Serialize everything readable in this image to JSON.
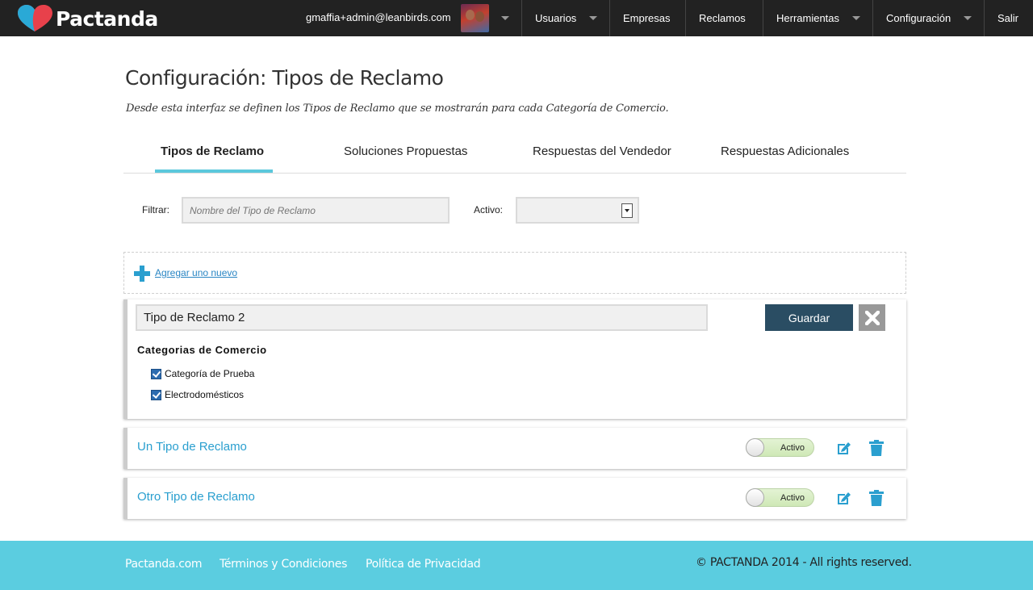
{
  "header": {
    "logo_text": "Pactanda",
    "user_email": "gmaffia+admin@leanbirds.com",
    "nav": [
      {
        "label": "Usuarios"
      },
      {
        "label": "Empresas"
      },
      {
        "label": "Reclamos"
      },
      {
        "label": "Herramientas"
      },
      {
        "label": "Configuración"
      },
      {
        "label": "Salir"
      }
    ]
  },
  "page": {
    "title": "Configuración: Tipos de Reclamo",
    "description": "Desde esta interfaz se definen los Tipos de Reclamo que se mostrarán para cada Categoría de Comercio."
  },
  "tabs": [
    {
      "label": "Tipos de Reclamo",
      "active": true
    },
    {
      "label": "Soluciones Propuestas"
    },
    {
      "label": "Respuestas del Vendedor"
    },
    {
      "label": "Respuestas Adicionales"
    }
  ],
  "filters": {
    "filter_label": "Filtrar:",
    "filter_placeholder": "Nombre del Tipo de Reclamo",
    "active_label": "Activo:",
    "active_value": ""
  },
  "add_new": {
    "label": "Agregar uno nuevo"
  },
  "edit_form": {
    "name_value": "Tipo de Reclamo 2",
    "save_label": "Guardar",
    "categories_heading": "Categorias de Comercio",
    "categories": [
      {
        "label": "Categoría de Prueba",
        "checked": true
      },
      {
        "label": "Electrodomésticos",
        "checked": true
      }
    ]
  },
  "items": [
    {
      "name": "Un Tipo de Reclamo",
      "status_label": "Activo"
    },
    {
      "name": "Otro Tipo de Reclamo",
      "status_label": "Activo"
    }
  ],
  "footer": {
    "links": [
      {
        "label": "Pactanda.com"
      },
      {
        "label": "Términos y Condiciones"
      },
      {
        "label": "Política de Privacidad"
      }
    ],
    "copyright": "© PACTANDA 2014 - All rights reserved."
  },
  "colors": {
    "topbar": "#222222",
    "accent": "#5bc8dc",
    "link": "#2a9fcf",
    "save_button": "#2a4d63",
    "footer": "#5bcde0"
  }
}
